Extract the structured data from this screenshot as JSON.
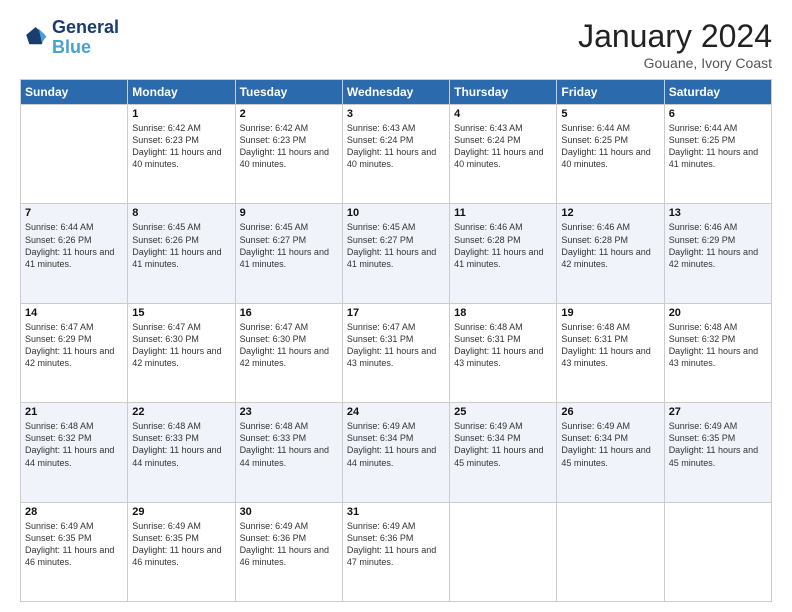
{
  "header": {
    "logo_line1": "General",
    "logo_line2": "Blue",
    "month": "January 2024",
    "location": "Gouane, Ivory Coast"
  },
  "days_of_week": [
    "Sunday",
    "Monday",
    "Tuesday",
    "Wednesday",
    "Thursday",
    "Friday",
    "Saturday"
  ],
  "weeks": [
    [
      {
        "day": "",
        "sunrise": "",
        "sunset": "",
        "daylight": ""
      },
      {
        "day": "1",
        "sunrise": "Sunrise: 6:42 AM",
        "sunset": "Sunset: 6:23 PM",
        "daylight": "Daylight: 11 hours and 40 minutes."
      },
      {
        "day": "2",
        "sunrise": "Sunrise: 6:42 AM",
        "sunset": "Sunset: 6:23 PM",
        "daylight": "Daylight: 11 hours and 40 minutes."
      },
      {
        "day": "3",
        "sunrise": "Sunrise: 6:43 AM",
        "sunset": "Sunset: 6:24 PM",
        "daylight": "Daylight: 11 hours and 40 minutes."
      },
      {
        "day": "4",
        "sunrise": "Sunrise: 6:43 AM",
        "sunset": "Sunset: 6:24 PM",
        "daylight": "Daylight: 11 hours and 40 minutes."
      },
      {
        "day": "5",
        "sunrise": "Sunrise: 6:44 AM",
        "sunset": "Sunset: 6:25 PM",
        "daylight": "Daylight: 11 hours and 40 minutes."
      },
      {
        "day": "6",
        "sunrise": "Sunrise: 6:44 AM",
        "sunset": "Sunset: 6:25 PM",
        "daylight": "Daylight: 11 hours and 41 minutes."
      }
    ],
    [
      {
        "day": "7",
        "sunrise": "Sunrise: 6:44 AM",
        "sunset": "Sunset: 6:26 PM",
        "daylight": "Daylight: 11 hours and 41 minutes."
      },
      {
        "day": "8",
        "sunrise": "Sunrise: 6:45 AM",
        "sunset": "Sunset: 6:26 PM",
        "daylight": "Daylight: 11 hours and 41 minutes."
      },
      {
        "day": "9",
        "sunrise": "Sunrise: 6:45 AM",
        "sunset": "Sunset: 6:27 PM",
        "daylight": "Daylight: 11 hours and 41 minutes."
      },
      {
        "day": "10",
        "sunrise": "Sunrise: 6:45 AM",
        "sunset": "Sunset: 6:27 PM",
        "daylight": "Daylight: 11 hours and 41 minutes."
      },
      {
        "day": "11",
        "sunrise": "Sunrise: 6:46 AM",
        "sunset": "Sunset: 6:28 PM",
        "daylight": "Daylight: 11 hours and 41 minutes."
      },
      {
        "day": "12",
        "sunrise": "Sunrise: 6:46 AM",
        "sunset": "Sunset: 6:28 PM",
        "daylight": "Daylight: 11 hours and 42 minutes."
      },
      {
        "day": "13",
        "sunrise": "Sunrise: 6:46 AM",
        "sunset": "Sunset: 6:29 PM",
        "daylight": "Daylight: 11 hours and 42 minutes."
      }
    ],
    [
      {
        "day": "14",
        "sunrise": "Sunrise: 6:47 AM",
        "sunset": "Sunset: 6:29 PM",
        "daylight": "Daylight: 11 hours and 42 minutes."
      },
      {
        "day": "15",
        "sunrise": "Sunrise: 6:47 AM",
        "sunset": "Sunset: 6:30 PM",
        "daylight": "Daylight: 11 hours and 42 minutes."
      },
      {
        "day": "16",
        "sunrise": "Sunrise: 6:47 AM",
        "sunset": "Sunset: 6:30 PM",
        "daylight": "Daylight: 11 hours and 42 minutes."
      },
      {
        "day": "17",
        "sunrise": "Sunrise: 6:47 AM",
        "sunset": "Sunset: 6:31 PM",
        "daylight": "Daylight: 11 hours and 43 minutes."
      },
      {
        "day": "18",
        "sunrise": "Sunrise: 6:48 AM",
        "sunset": "Sunset: 6:31 PM",
        "daylight": "Daylight: 11 hours and 43 minutes."
      },
      {
        "day": "19",
        "sunrise": "Sunrise: 6:48 AM",
        "sunset": "Sunset: 6:31 PM",
        "daylight": "Daylight: 11 hours and 43 minutes."
      },
      {
        "day": "20",
        "sunrise": "Sunrise: 6:48 AM",
        "sunset": "Sunset: 6:32 PM",
        "daylight": "Daylight: 11 hours and 43 minutes."
      }
    ],
    [
      {
        "day": "21",
        "sunrise": "Sunrise: 6:48 AM",
        "sunset": "Sunset: 6:32 PM",
        "daylight": "Daylight: 11 hours and 44 minutes."
      },
      {
        "day": "22",
        "sunrise": "Sunrise: 6:48 AM",
        "sunset": "Sunset: 6:33 PM",
        "daylight": "Daylight: 11 hours and 44 minutes."
      },
      {
        "day": "23",
        "sunrise": "Sunrise: 6:48 AM",
        "sunset": "Sunset: 6:33 PM",
        "daylight": "Daylight: 11 hours and 44 minutes."
      },
      {
        "day": "24",
        "sunrise": "Sunrise: 6:49 AM",
        "sunset": "Sunset: 6:34 PM",
        "daylight": "Daylight: 11 hours and 44 minutes."
      },
      {
        "day": "25",
        "sunrise": "Sunrise: 6:49 AM",
        "sunset": "Sunset: 6:34 PM",
        "daylight": "Daylight: 11 hours and 45 minutes."
      },
      {
        "day": "26",
        "sunrise": "Sunrise: 6:49 AM",
        "sunset": "Sunset: 6:34 PM",
        "daylight": "Daylight: 11 hours and 45 minutes."
      },
      {
        "day": "27",
        "sunrise": "Sunrise: 6:49 AM",
        "sunset": "Sunset: 6:35 PM",
        "daylight": "Daylight: 11 hours and 45 minutes."
      }
    ],
    [
      {
        "day": "28",
        "sunrise": "Sunrise: 6:49 AM",
        "sunset": "Sunset: 6:35 PM",
        "daylight": "Daylight: 11 hours and 46 minutes."
      },
      {
        "day": "29",
        "sunrise": "Sunrise: 6:49 AM",
        "sunset": "Sunset: 6:35 PM",
        "daylight": "Daylight: 11 hours and 46 minutes."
      },
      {
        "day": "30",
        "sunrise": "Sunrise: 6:49 AM",
        "sunset": "Sunset: 6:36 PM",
        "daylight": "Daylight: 11 hours and 46 minutes."
      },
      {
        "day": "31",
        "sunrise": "Sunrise: 6:49 AM",
        "sunset": "Sunset: 6:36 PM",
        "daylight": "Daylight: 11 hours and 47 minutes."
      },
      {
        "day": "",
        "sunrise": "",
        "sunset": "",
        "daylight": ""
      },
      {
        "day": "",
        "sunrise": "",
        "sunset": "",
        "daylight": ""
      },
      {
        "day": "",
        "sunrise": "",
        "sunset": "",
        "daylight": ""
      }
    ]
  ]
}
